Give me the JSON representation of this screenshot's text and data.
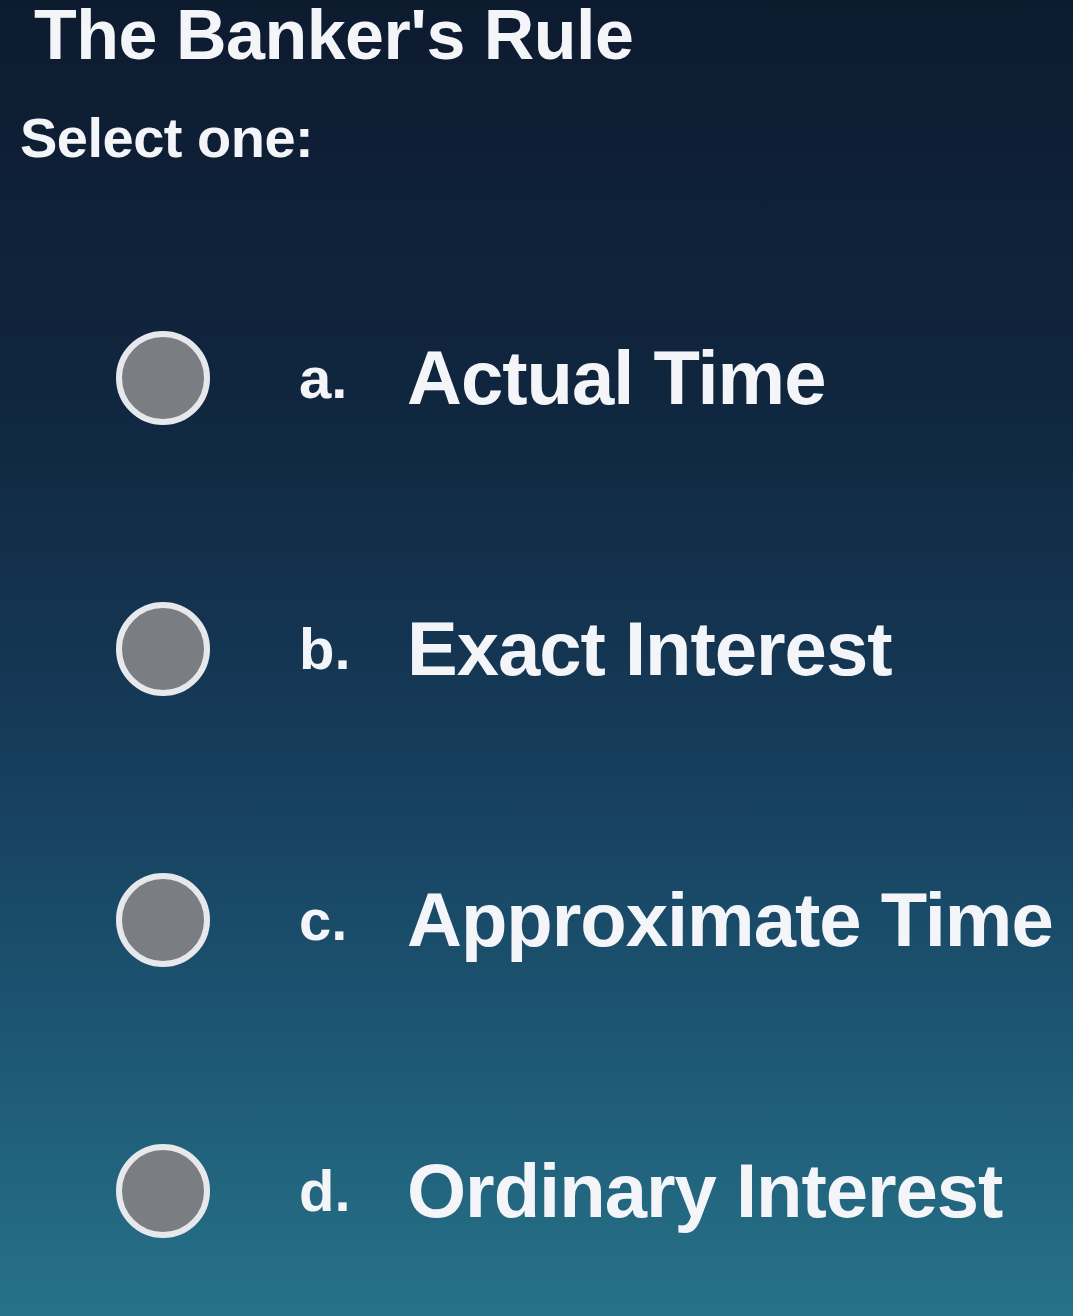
{
  "question": {
    "title": "The Banker's Rule",
    "prompt": "Select one:"
  },
  "options": [
    {
      "letter": "a.",
      "text": "Actual Time",
      "selected": false
    },
    {
      "letter": "b.",
      "text": "Exact Interest",
      "selected": false
    },
    {
      "letter": "c.",
      "text": "Approximate Time",
      "selected": false
    },
    {
      "letter": "d.",
      "text": "Ordinary Interest",
      "selected": false
    }
  ]
}
